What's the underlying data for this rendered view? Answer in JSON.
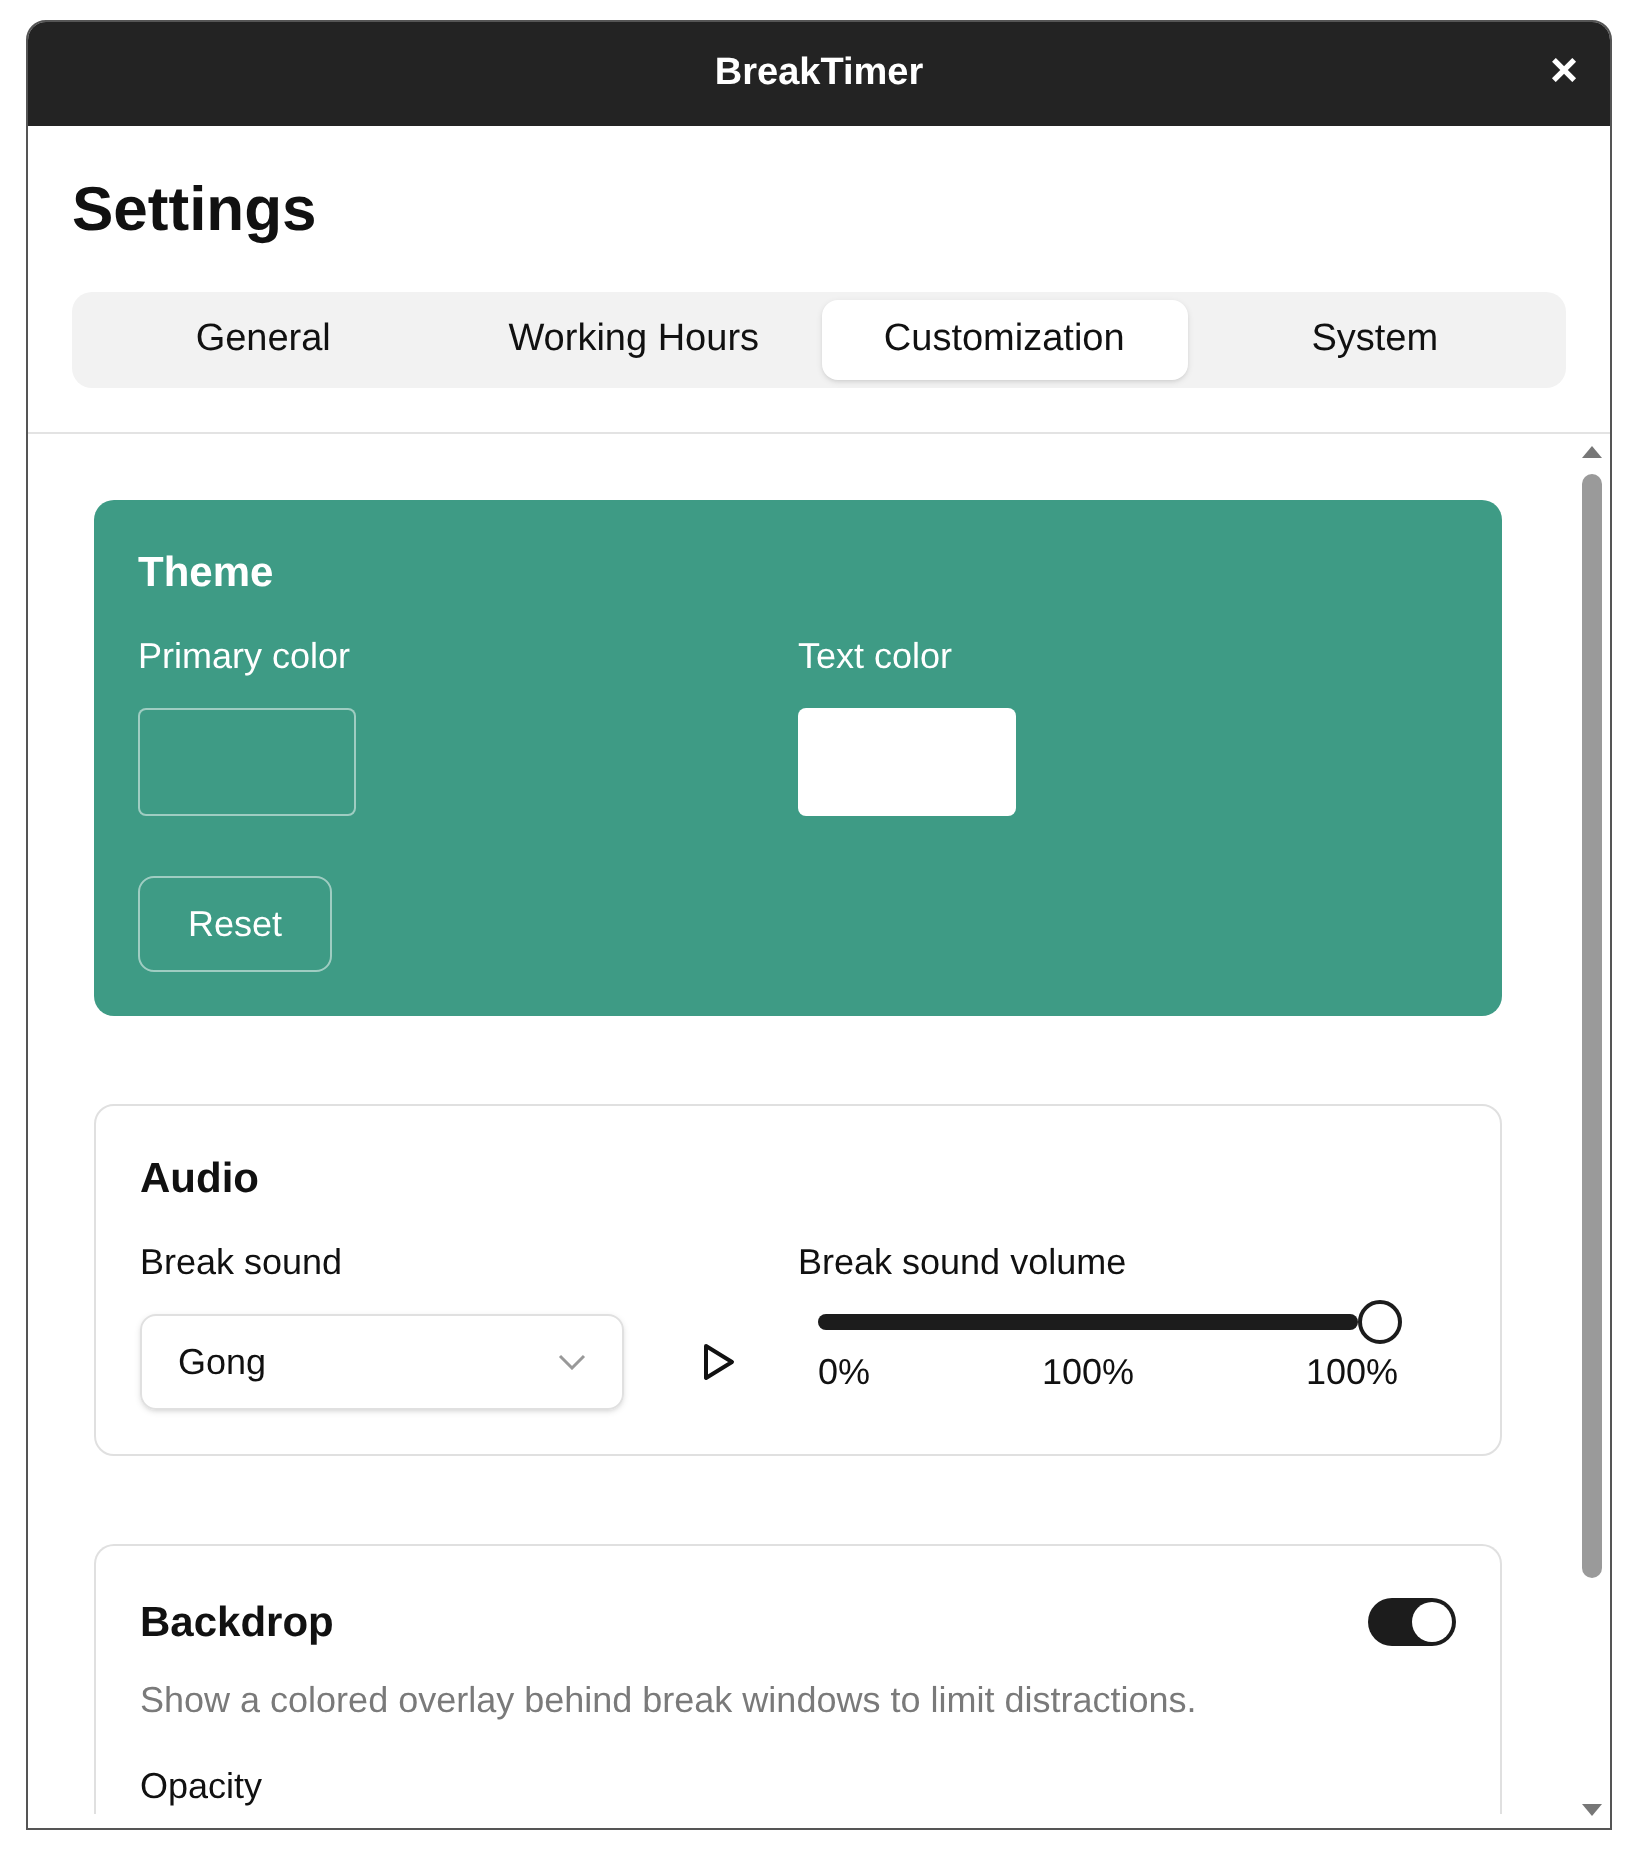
{
  "window": {
    "title": "BreakTimer",
    "close": "×"
  },
  "heading": "Settings",
  "tabs": [
    {
      "label": "General",
      "selected": false
    },
    {
      "label": "Working Hours",
      "selected": false
    },
    {
      "label": "Customization",
      "selected": true
    },
    {
      "label": "System",
      "selected": false
    }
  ],
  "theme": {
    "title": "Theme",
    "swatches": [
      {
        "label": "Primary color",
        "color": "#3e9b85"
      },
      {
        "label": "Text color",
        "color": "#ffffff"
      }
    ],
    "reset_button": "Reset"
  },
  "audio": {
    "title": "Audio",
    "sound_label": "Break sound",
    "sound_value": "Gong",
    "volume_label": "Break sound volume",
    "volume": {
      "level": 1,
      "min": "0%",
      "current": "100%",
      "max": "100%"
    }
  },
  "backdrop": {
    "title": "Backdrop",
    "on": true,
    "description": "Show a colored overlay behind break windows to limit distractions.",
    "opacity_label": "Opacity"
  }
}
